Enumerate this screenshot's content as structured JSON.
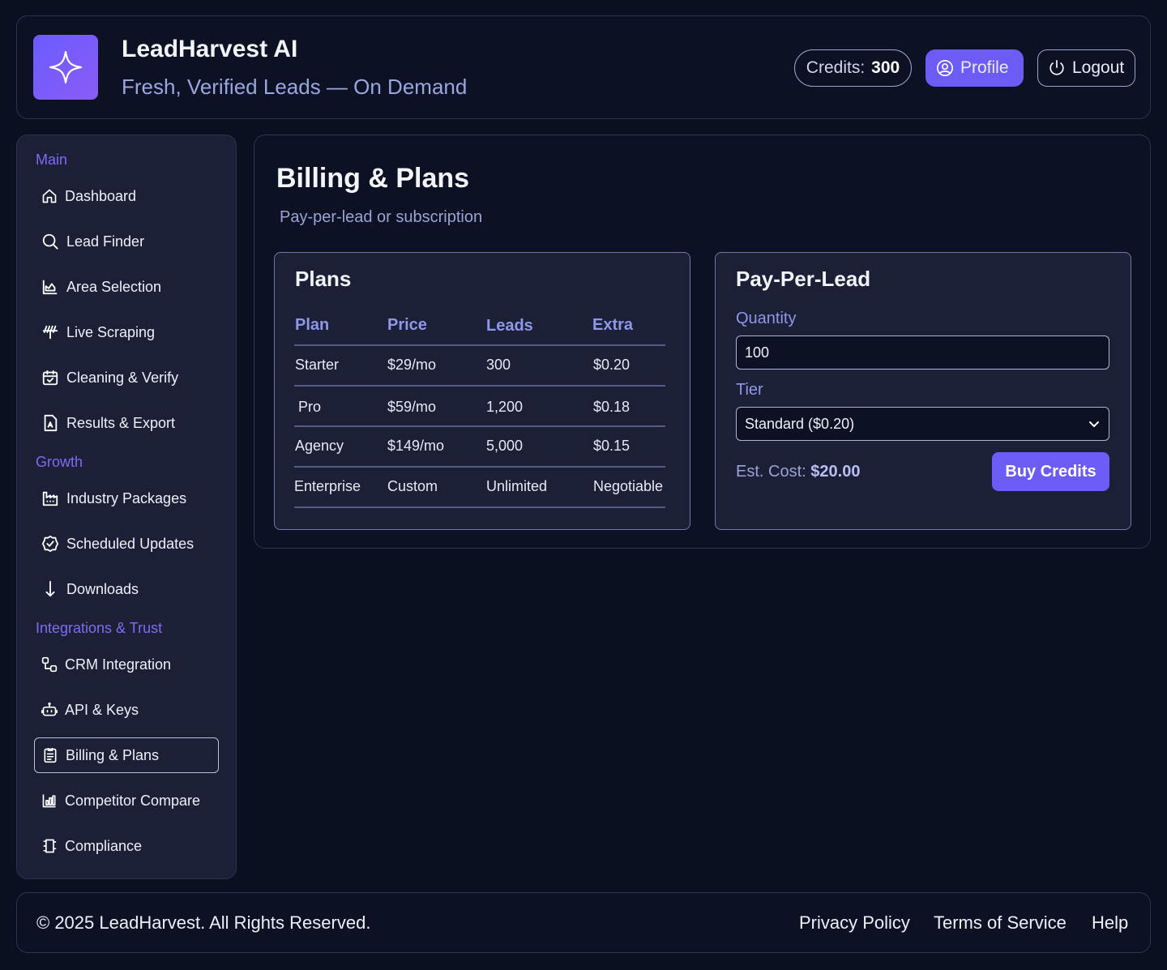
{
  "header": {
    "title": "LeadHarvest AI",
    "tagline": "Fresh, Verified Leads — On Demand",
    "credits_label": "Credits:",
    "credits_value": "300",
    "profile_label": "Profile",
    "logout_label": "Logout",
    "accent": "#6c5cf6"
  },
  "sidebar": {
    "sections": [
      {
        "title": "Main"
      },
      {
        "title": "Growth"
      },
      {
        "title": "Integrations & Trust"
      }
    ],
    "items": [
      {
        "label": "Dashboard",
        "icon": "home-icon"
      },
      {
        "label": "Lead Finder",
        "icon": "search-icon"
      },
      {
        "label": "Area Selection",
        "icon": "chart-icon"
      },
      {
        "label": "Live Scraping",
        "icon": "scrape-icon"
      },
      {
        "label": "Cleaning & Verify",
        "icon": "calendar-check-icon"
      },
      {
        "label": "Results & Export",
        "icon": "document-icon"
      },
      {
        "label": "Industry Packages",
        "icon": "factory-icon"
      },
      {
        "label": "Scheduled Updates",
        "icon": "check-badge-icon"
      },
      {
        "label": "Downloads",
        "icon": "arrow-down-icon"
      },
      {
        "label": "CRM Integration",
        "icon": "nodes-icon"
      },
      {
        "label": "API & Keys",
        "icon": "robot-icon"
      },
      {
        "label": "Billing & Plans",
        "icon": "receipt-icon"
      },
      {
        "label": "Competitor Compare",
        "icon": "bar-chart-icon"
      },
      {
        "label": "Compliance",
        "icon": "scroll-icon"
      }
    ],
    "active": "Billing & Plans"
  },
  "main": {
    "title": "Billing & Plans",
    "subtitle": "Pay-per-lead or subscription",
    "plans": {
      "title": "Plans",
      "columns": [
        "Plan",
        "Price",
        "Leads",
        "Extra"
      ],
      "rows": [
        [
          "Starter",
          "$29/mo",
          "300",
          "$0.20"
        ],
        [
          "Pro",
          "$59/mo",
          "1,200",
          "$0.18"
        ],
        [
          "Agency",
          "$149/mo",
          "5,000",
          "$0.15"
        ],
        [
          "Enterprise",
          "Custom",
          "Unlimited",
          "Negotiable"
        ]
      ]
    },
    "ppl": {
      "title": "Pay-Per-Lead",
      "quantity_label": "Quantity",
      "quantity_value": "100",
      "tier_label": "Tier",
      "tier_value": "Standard ($0.20)",
      "est_label": "Est. Cost:",
      "est_value": "$20.00",
      "buy_label": "Buy Credits"
    }
  },
  "footer": {
    "copyright": "© 2025 LeadHarvest. All Rights Reserved.",
    "links": [
      "Privacy Policy",
      "Terms of Service",
      "Help"
    ]
  }
}
